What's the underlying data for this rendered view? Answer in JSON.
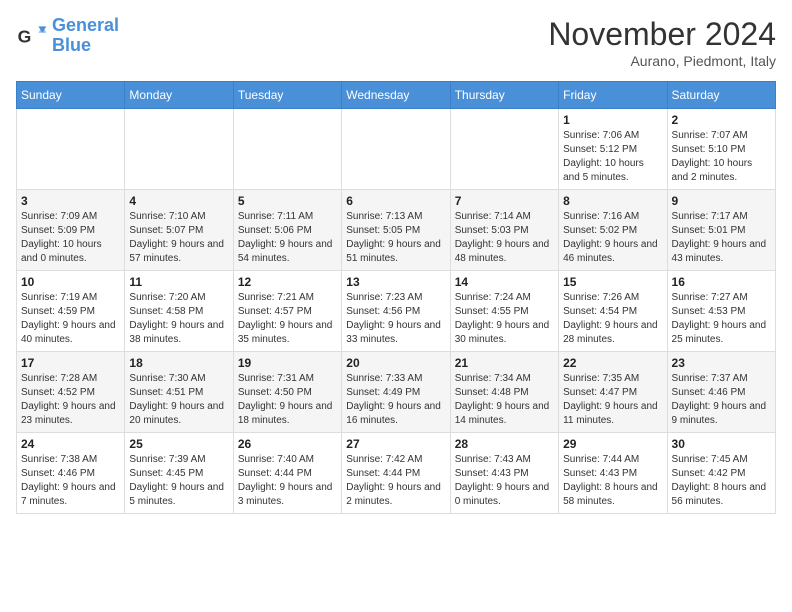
{
  "logo": {
    "line1": "General",
    "line2": "Blue"
  },
  "title": "November 2024",
  "subtitle": "Aurano, Piedmont, Italy",
  "days_header": [
    "Sunday",
    "Monday",
    "Tuesday",
    "Wednesday",
    "Thursday",
    "Friday",
    "Saturday"
  ],
  "weeks": [
    [
      {
        "day": "",
        "info": ""
      },
      {
        "day": "",
        "info": ""
      },
      {
        "day": "",
        "info": ""
      },
      {
        "day": "",
        "info": ""
      },
      {
        "day": "",
        "info": ""
      },
      {
        "day": "1",
        "info": "Sunrise: 7:06 AM\nSunset: 5:12 PM\nDaylight: 10 hours and 5 minutes."
      },
      {
        "day": "2",
        "info": "Sunrise: 7:07 AM\nSunset: 5:10 PM\nDaylight: 10 hours and 2 minutes."
      }
    ],
    [
      {
        "day": "3",
        "info": "Sunrise: 7:09 AM\nSunset: 5:09 PM\nDaylight: 10 hours and 0 minutes."
      },
      {
        "day": "4",
        "info": "Sunrise: 7:10 AM\nSunset: 5:07 PM\nDaylight: 9 hours and 57 minutes."
      },
      {
        "day": "5",
        "info": "Sunrise: 7:11 AM\nSunset: 5:06 PM\nDaylight: 9 hours and 54 minutes."
      },
      {
        "day": "6",
        "info": "Sunrise: 7:13 AM\nSunset: 5:05 PM\nDaylight: 9 hours and 51 minutes."
      },
      {
        "day": "7",
        "info": "Sunrise: 7:14 AM\nSunset: 5:03 PM\nDaylight: 9 hours and 48 minutes."
      },
      {
        "day": "8",
        "info": "Sunrise: 7:16 AM\nSunset: 5:02 PM\nDaylight: 9 hours and 46 minutes."
      },
      {
        "day": "9",
        "info": "Sunrise: 7:17 AM\nSunset: 5:01 PM\nDaylight: 9 hours and 43 minutes."
      }
    ],
    [
      {
        "day": "10",
        "info": "Sunrise: 7:19 AM\nSunset: 4:59 PM\nDaylight: 9 hours and 40 minutes."
      },
      {
        "day": "11",
        "info": "Sunrise: 7:20 AM\nSunset: 4:58 PM\nDaylight: 9 hours and 38 minutes."
      },
      {
        "day": "12",
        "info": "Sunrise: 7:21 AM\nSunset: 4:57 PM\nDaylight: 9 hours and 35 minutes."
      },
      {
        "day": "13",
        "info": "Sunrise: 7:23 AM\nSunset: 4:56 PM\nDaylight: 9 hours and 33 minutes."
      },
      {
        "day": "14",
        "info": "Sunrise: 7:24 AM\nSunset: 4:55 PM\nDaylight: 9 hours and 30 minutes."
      },
      {
        "day": "15",
        "info": "Sunrise: 7:26 AM\nSunset: 4:54 PM\nDaylight: 9 hours and 28 minutes."
      },
      {
        "day": "16",
        "info": "Sunrise: 7:27 AM\nSunset: 4:53 PM\nDaylight: 9 hours and 25 minutes."
      }
    ],
    [
      {
        "day": "17",
        "info": "Sunrise: 7:28 AM\nSunset: 4:52 PM\nDaylight: 9 hours and 23 minutes."
      },
      {
        "day": "18",
        "info": "Sunrise: 7:30 AM\nSunset: 4:51 PM\nDaylight: 9 hours and 20 minutes."
      },
      {
        "day": "19",
        "info": "Sunrise: 7:31 AM\nSunset: 4:50 PM\nDaylight: 9 hours and 18 minutes."
      },
      {
        "day": "20",
        "info": "Sunrise: 7:33 AM\nSunset: 4:49 PM\nDaylight: 9 hours and 16 minutes."
      },
      {
        "day": "21",
        "info": "Sunrise: 7:34 AM\nSunset: 4:48 PM\nDaylight: 9 hours and 14 minutes."
      },
      {
        "day": "22",
        "info": "Sunrise: 7:35 AM\nSunset: 4:47 PM\nDaylight: 9 hours and 11 minutes."
      },
      {
        "day": "23",
        "info": "Sunrise: 7:37 AM\nSunset: 4:46 PM\nDaylight: 9 hours and 9 minutes."
      }
    ],
    [
      {
        "day": "24",
        "info": "Sunrise: 7:38 AM\nSunset: 4:46 PM\nDaylight: 9 hours and 7 minutes."
      },
      {
        "day": "25",
        "info": "Sunrise: 7:39 AM\nSunset: 4:45 PM\nDaylight: 9 hours and 5 minutes."
      },
      {
        "day": "26",
        "info": "Sunrise: 7:40 AM\nSunset: 4:44 PM\nDaylight: 9 hours and 3 minutes."
      },
      {
        "day": "27",
        "info": "Sunrise: 7:42 AM\nSunset: 4:44 PM\nDaylight: 9 hours and 2 minutes."
      },
      {
        "day": "28",
        "info": "Sunrise: 7:43 AM\nSunset: 4:43 PM\nDaylight: 9 hours and 0 minutes."
      },
      {
        "day": "29",
        "info": "Sunrise: 7:44 AM\nSunset: 4:43 PM\nDaylight: 8 hours and 58 minutes."
      },
      {
        "day": "30",
        "info": "Sunrise: 7:45 AM\nSunset: 4:42 PM\nDaylight: 8 hours and 56 minutes."
      }
    ]
  ]
}
